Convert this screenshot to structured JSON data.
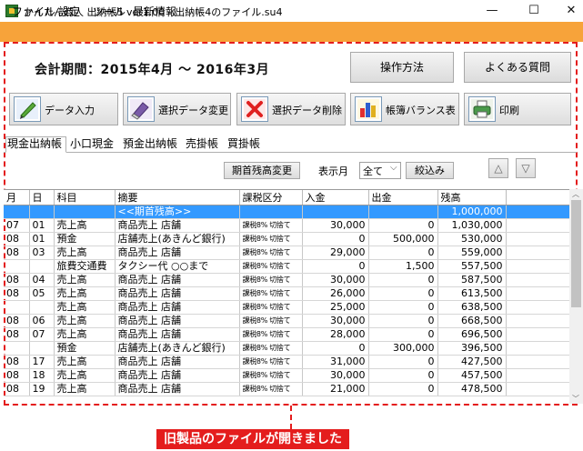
{
  "window": {
    "title": "かんたん商人 出納帳5 ver1.00 - 出納帳4のファイル.su4",
    "min_glyph": "—",
    "max_glyph": "☐",
    "close_glyph": "✕"
  },
  "menu": [
    "ファイル",
    "設定",
    "ツール",
    "最新情報"
  ],
  "period": {
    "label": "会計期間：2015年4月 〜 2016年3月"
  },
  "header_buttons": {
    "howto": "操作方法",
    "faq": "よくある質問"
  },
  "toolbar": [
    {
      "label": "データ入力",
      "icon": "pencil-icon"
    },
    {
      "label": "選択データ変更",
      "icon": "eraser-icon"
    },
    {
      "label": "選択データ削除",
      "icon": "delete-x-icon"
    },
    {
      "label": "帳簿バランス表",
      "icon": "bar-chart-icon"
    },
    {
      "label": "印刷",
      "icon": "printer-icon"
    }
  ],
  "tabs": [
    "現金出納帳",
    "小口現金",
    "預金出納帳",
    "売掛帳",
    "買掛帳"
  ],
  "controls": {
    "opening_balance_button": "期首残高変更",
    "display_month_label": "表示月",
    "display_month_value": "全て",
    "filter_button": "絞込み",
    "up_glyph": "△",
    "down_glyph": "▽"
  },
  "table": {
    "headers": [
      "月",
      "日",
      "科目",
      "摘要",
      "課税区分",
      "入金",
      "出金",
      "残高"
    ],
    "rows": [
      [
        "",
        "",
        "",
        "<<期首残高>>",
        "",
        "",
        "",
        "1,000,000"
      ],
      [
        "07",
        "01",
        "売上高",
        "商品売上 店舗",
        "課税8% 切捨て",
        "30,000",
        "0",
        "1,030,000"
      ],
      [
        "08",
        "01",
        "預金",
        "店舗売上(あきんど銀行)",
        "課税8% 切捨て",
        "0",
        "500,000",
        "530,000"
      ],
      [
        "08",
        "03",
        "売上高",
        "商品売上 店舗",
        "課税8% 切捨て",
        "29,000",
        "0",
        "559,000"
      ],
      [
        "",
        "",
        "旅費交通費",
        "タクシー代 ○○まで",
        "課税8% 切捨て",
        "0",
        "1,500",
        "557,500"
      ],
      [
        "08",
        "04",
        "売上高",
        "商品売上 店舗",
        "課税8% 切捨て",
        "30,000",
        "0",
        "587,500"
      ],
      [
        "08",
        "05",
        "売上高",
        "商品売上 店舗",
        "課税8% 切捨て",
        "26,000",
        "0",
        "613,500"
      ],
      [
        "",
        "",
        "売上高",
        "商品売上 店舗",
        "課税8% 切捨て",
        "25,000",
        "0",
        "638,500"
      ],
      [
        "08",
        "06",
        "売上高",
        "商品売上 店舗",
        "課税8% 切捨て",
        "30,000",
        "0",
        "668,500"
      ],
      [
        "08",
        "07",
        "売上高",
        "商品売上 店舗",
        "課税8% 切捨て",
        "28,000",
        "0",
        "696,500"
      ],
      [
        "",
        "",
        "預金",
        "店舗売上(あきんど銀行)",
        "課税8% 切捨て",
        "0",
        "300,000",
        "396,500"
      ],
      [
        "08",
        "17",
        "売上高",
        "商品売上 店舗",
        "課税8% 切捨て",
        "31,000",
        "0",
        "427,500"
      ],
      [
        "08",
        "18",
        "売上高",
        "商品売上 店舗",
        "課税8% 切捨て",
        "30,000",
        "0",
        "457,500"
      ],
      [
        "08",
        "19",
        "売上高",
        "商品売上 店舗",
        "課税8% 切捨て",
        "21,000",
        "0",
        "478,500"
      ]
    ]
  },
  "caption": "旧製品のファイルが開きました",
  "colors": {
    "menu_bg": "#f7a33a",
    "selection": "#3399ff",
    "annotation": "#e41d1d"
  }
}
